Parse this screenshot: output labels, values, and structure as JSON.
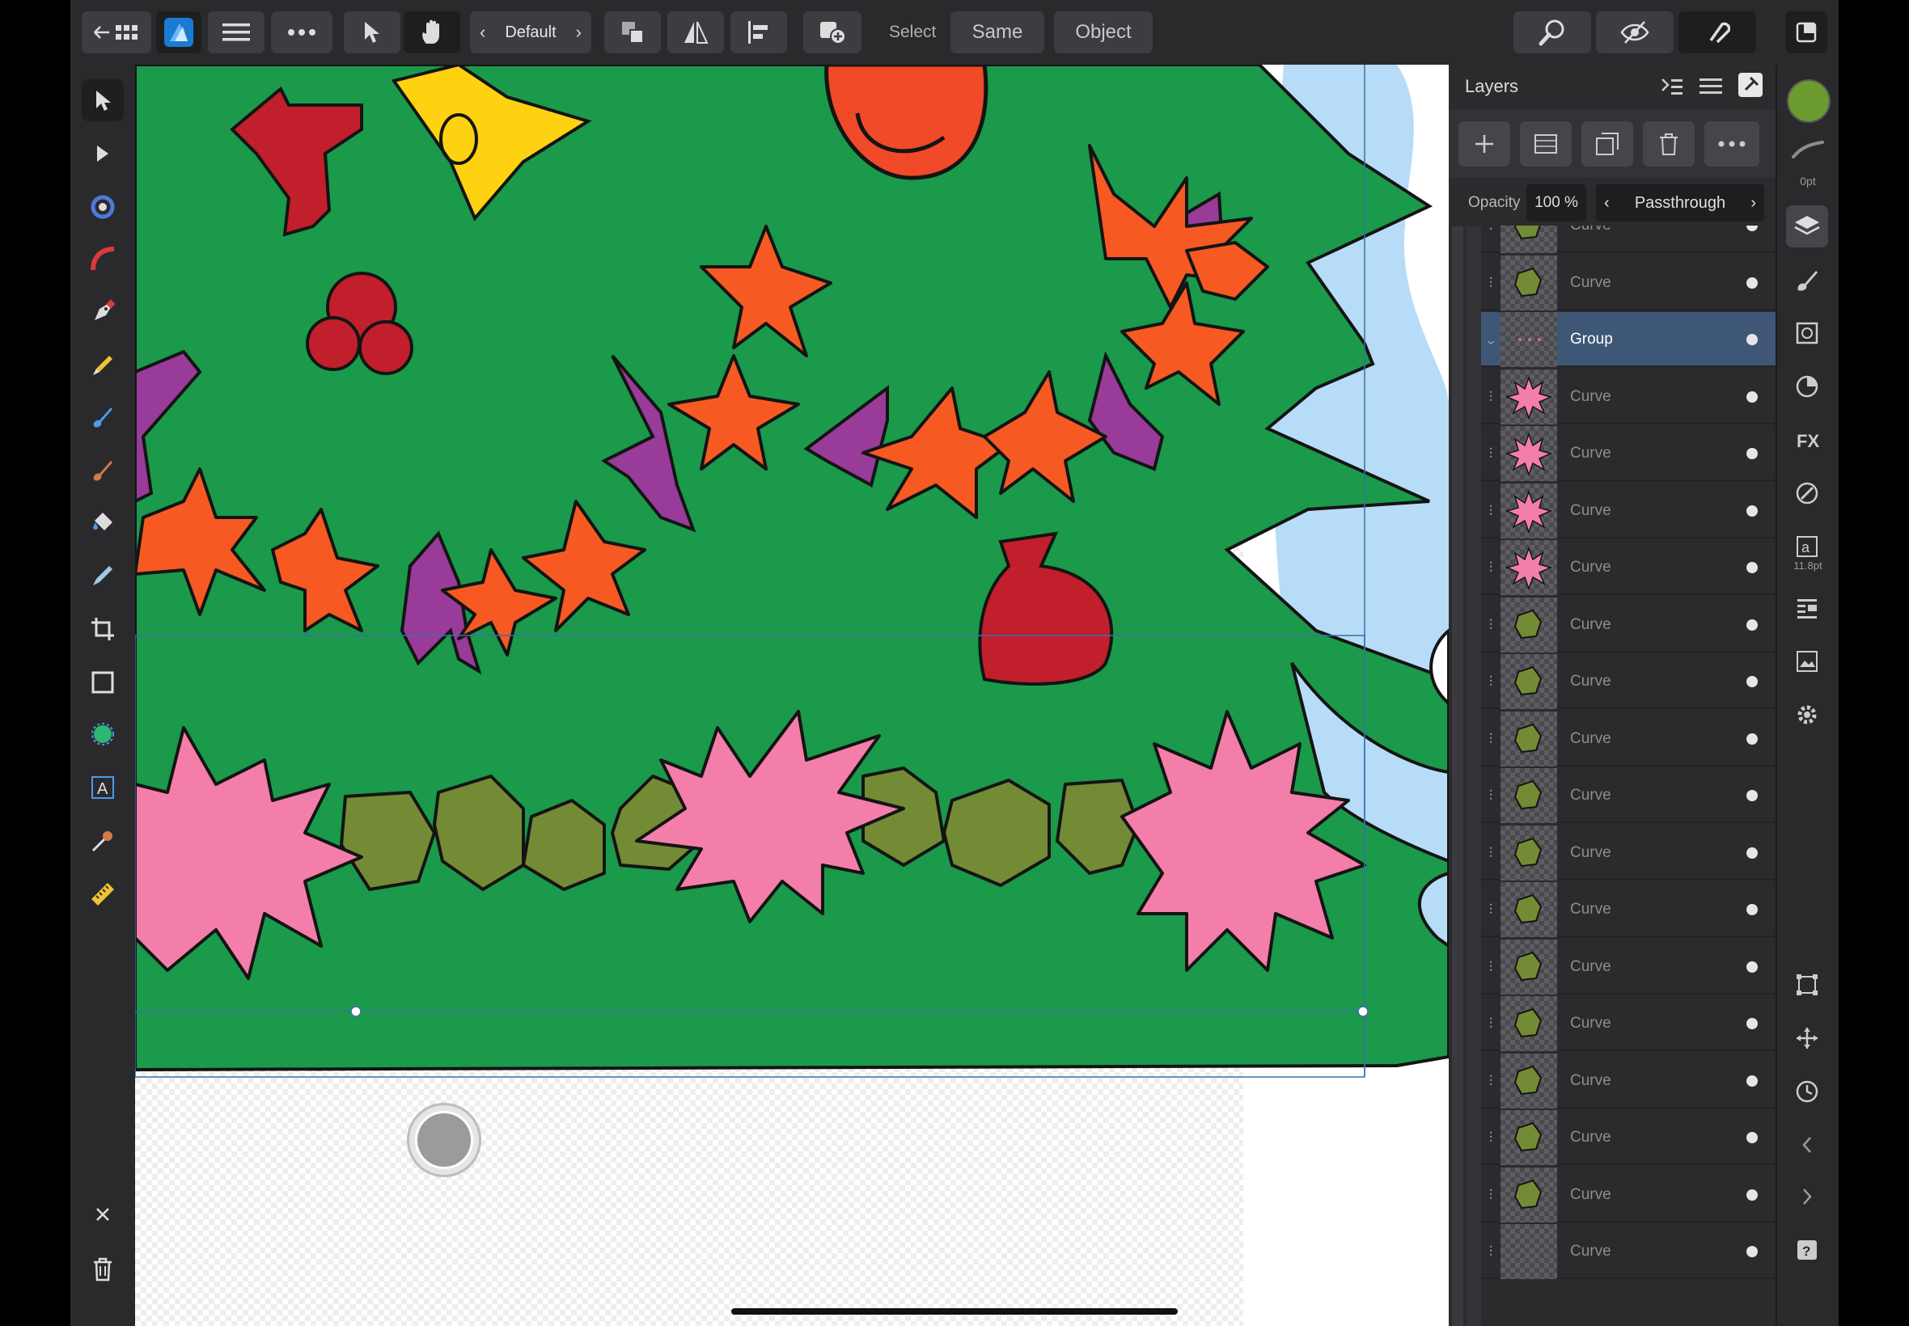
{
  "toolbar": {
    "persona_label": "Default",
    "select_label": "Select",
    "same_label": "Same",
    "object_label": "Object"
  },
  "layers_panel": {
    "title": "Layers",
    "opacity_label": "Opacity",
    "opacity_value": "100 %",
    "blend_mode": "Passthrough",
    "rows": [
      {
        "name": "Curve",
        "thumb": "green"
      },
      {
        "name": "Curve",
        "thumb": "green"
      },
      {
        "name": "Group",
        "thumb": "group"
      },
      {
        "name": "Curve",
        "thumb": "pink"
      },
      {
        "name": "Curve",
        "thumb": "pink"
      },
      {
        "name": "Curve",
        "thumb": "pink"
      },
      {
        "name": "Curve",
        "thumb": "pink"
      },
      {
        "name": "Curve",
        "thumb": "green"
      },
      {
        "name": "Curve",
        "thumb": "green"
      },
      {
        "name": "Curve",
        "thumb": "green"
      },
      {
        "name": "Curve",
        "thumb": "green"
      },
      {
        "name": "Curve",
        "thumb": "green"
      },
      {
        "name": "Curve",
        "thumb": "green"
      },
      {
        "name": "Curve",
        "thumb": "green"
      },
      {
        "name": "Curve",
        "thumb": "green"
      },
      {
        "name": "Curve",
        "thumb": "green"
      },
      {
        "name": "Curve",
        "thumb": "green"
      },
      {
        "name": "Curve",
        "thumb": "green"
      },
      {
        "name": "Curve",
        "thumb": "none"
      }
    ]
  },
  "studio": {
    "stroke_width": "0pt",
    "font_size": "11.8pt"
  },
  "colors": {
    "fill_swatch": "#6b9a2e",
    "tree_green": "#1a9a4a",
    "selection": "#3f5776"
  }
}
